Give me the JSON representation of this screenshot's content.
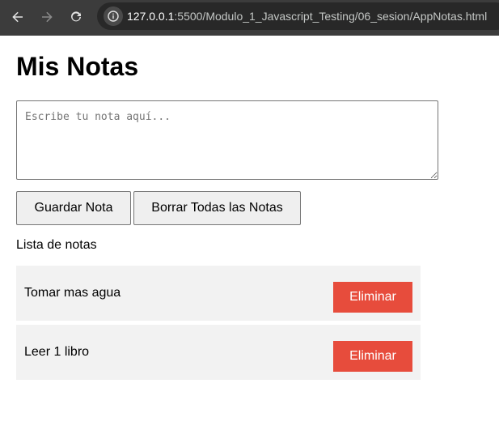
{
  "browser": {
    "url_host": "127.0.0.1",
    "url_path": ":5500/Modulo_1_Javascript_Testing/06_sesion/AppNotas.html",
    "colors": {
      "chrome_bg": "#3c3c3c",
      "address_bg": "#282828"
    }
  },
  "page": {
    "title": "Mis Notas",
    "textarea": {
      "placeholder": "Escribe tu nota aquí...",
      "value": ""
    },
    "buttons": {
      "save_label": "Guardar Nota",
      "clear_all_label": "Borrar Todas las Notas"
    },
    "list_heading": "Lista de notas",
    "notes": [
      {
        "text": "Tomar mas agua",
        "delete_label": "Eliminar"
      },
      {
        "text": "Leer 1 libro",
        "delete_label": "Eliminar"
      }
    ],
    "colors": {
      "delete_button": "#e74c3c",
      "note_bg": "#f2f2f2"
    }
  }
}
